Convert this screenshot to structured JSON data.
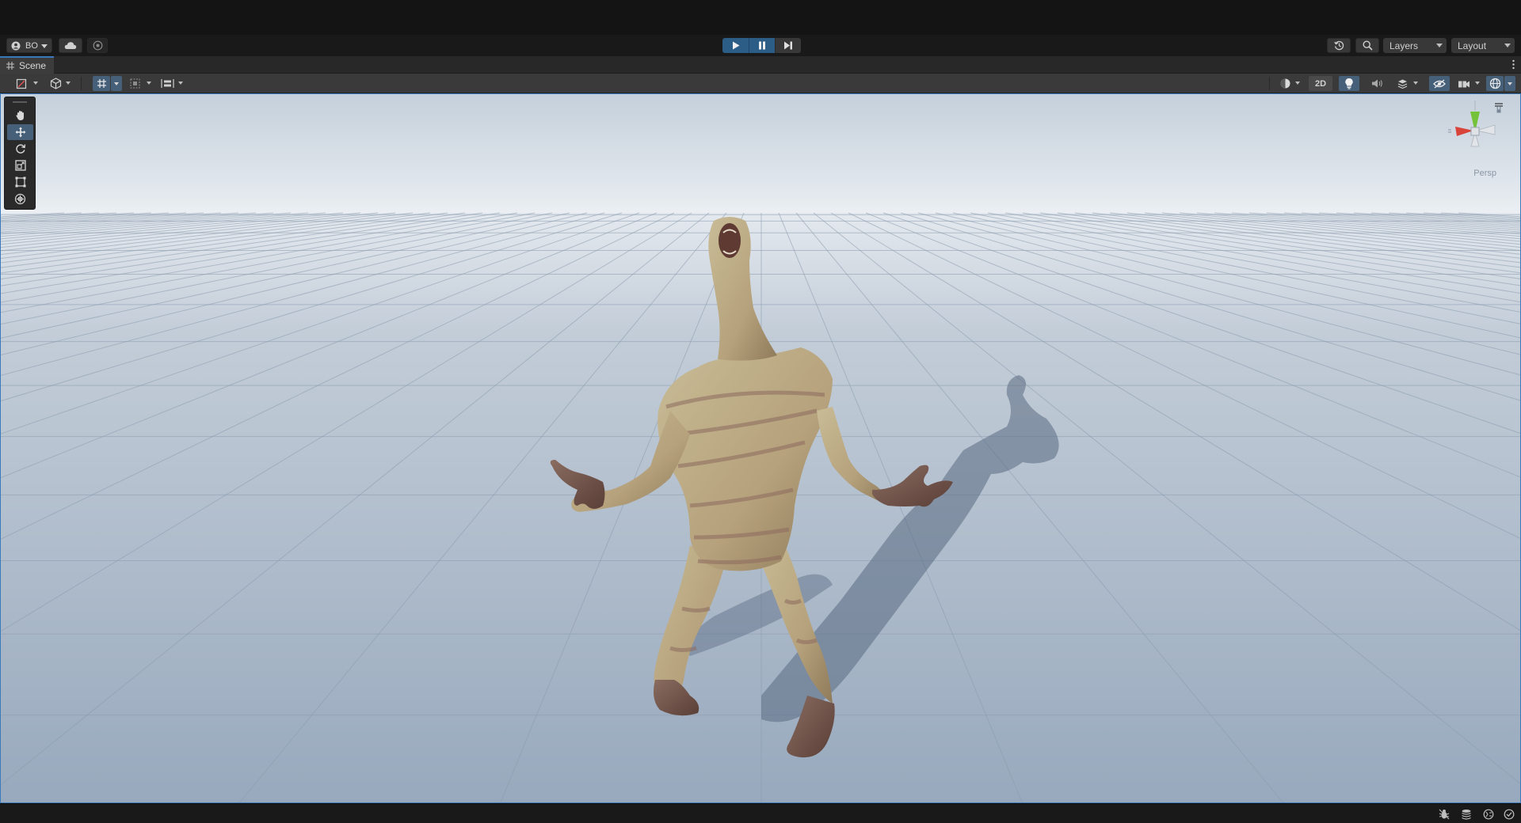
{
  "toolbar": {
    "account_label": "BO",
    "layers_label": "Layers",
    "layout_label": "Layout",
    "play_state": {
      "play_active": true,
      "pause_active": true,
      "step_active": false
    }
  },
  "tabs": [
    {
      "label": "Scene",
      "icon": "grid-icon"
    }
  ],
  "scene_toolbar": {
    "mode_2d_label": "2D",
    "left_tools": [
      "draw-mode-icon",
      "render-mode-icon",
      "grid-snapping-icon",
      "increment-snap-icon",
      "align-icon"
    ],
    "right_tools": [
      "shading-mode-icon",
      "2d-toggle",
      "lighting-icon",
      "audio-icon",
      "effects-icon",
      "hidden-objects-icon",
      "camera-icon",
      "gizmos-icon"
    ]
  },
  "tools_panel": {
    "tools": [
      "hand-tool-icon",
      "move-tool-icon",
      "rotate-tool-icon",
      "scale-tool-icon",
      "rect-tool-icon",
      "transform-tool-icon"
    ],
    "active": "move-tool-icon"
  },
  "gizmo": {
    "projection_label": "Persp",
    "axes": {
      "x": "#d8443a",
      "y": "#74c23a",
      "z": "#d4d4d4"
    }
  },
  "colors": {
    "accent": "#3a79bb",
    "play_active": "#2c5d87",
    "sky_top": "#c9d4de",
    "horizon": "#eef2f6",
    "ground": "#a3b3c6"
  },
  "status_icons": [
    "bug-icon",
    "cache-icon",
    "network-icon",
    "check-icon"
  ]
}
